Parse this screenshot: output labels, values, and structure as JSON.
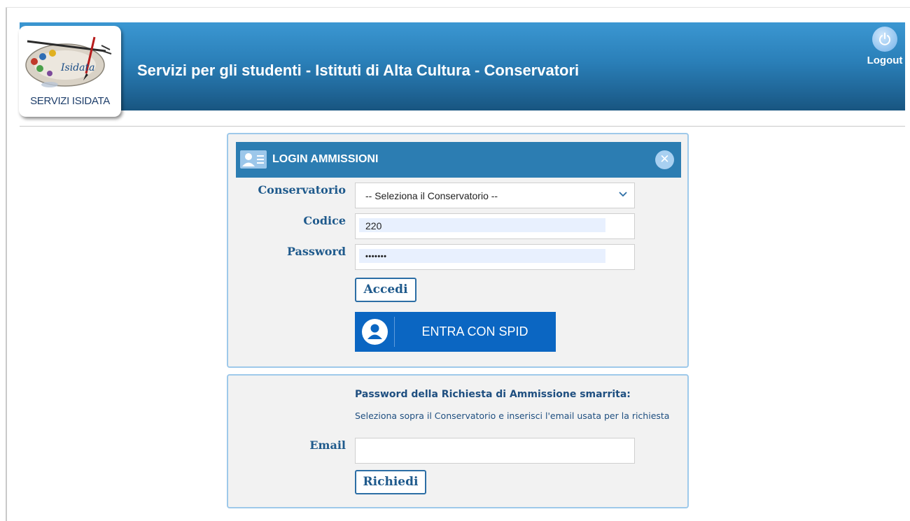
{
  "header": {
    "logo_caption": "SERVIZI ISIDATA",
    "logo_wordmark": "Isidata",
    "title": "Servizi per gli studenti - Istituti di Alta Cultura - Conservatori",
    "logout_label": "Logout",
    "logout_icon": "power-icon"
  },
  "login": {
    "title": "LOGIN AMMISSIONI",
    "title_icon": "id-card-icon",
    "close_icon": "close-icon",
    "conservatorio_label": "Conservatorio",
    "conservatorio_value": "-- Seleziona il Conservatorio --",
    "codice_label": "Codice",
    "codice_value": "220",
    "password_label": "Password",
    "password_value": "•••••••",
    "submit_label": "Accedi",
    "spid_label": "ENTRA CON SPID",
    "spid_icon": "user-circle-icon"
  },
  "recover": {
    "title": "Password della Richiesta di Ammissione smarrita:",
    "hint": "Seleziona sopra il Conservatorio e inserisci l'email usata per la richiesta",
    "email_label": "Email",
    "email_value": "",
    "submit_label": "Richiedi"
  },
  "colors": {
    "header_blue": "#2a7fb8",
    "panel_border": "#9ec9ea",
    "spid_blue": "#0b66c2",
    "label_blue": "#1f5a8c"
  }
}
